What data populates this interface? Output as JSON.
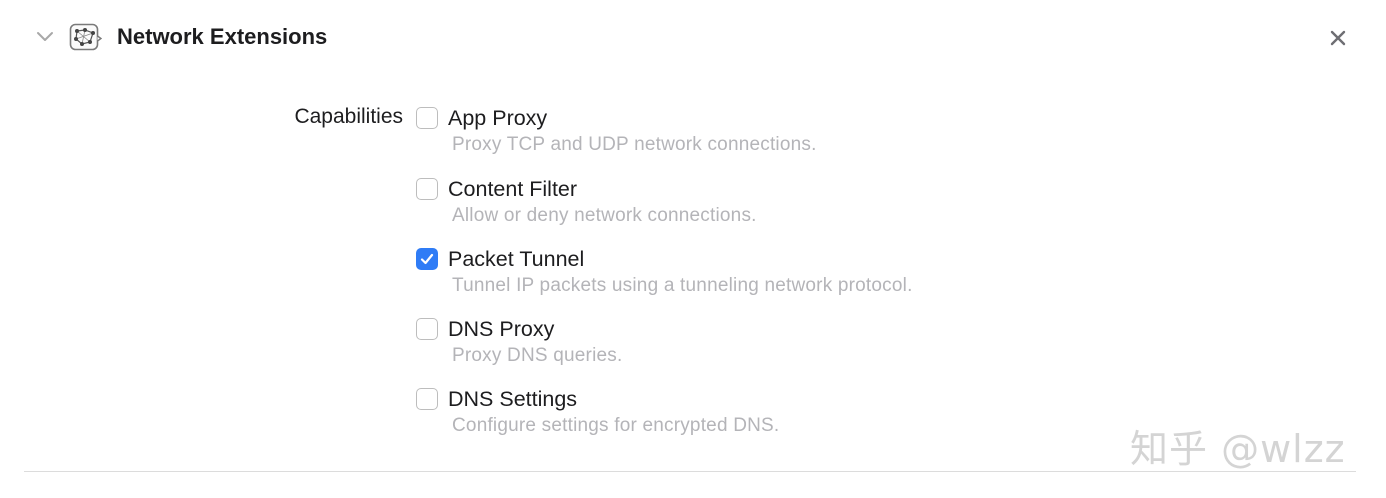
{
  "section": {
    "title": "Network Extensions",
    "icon": "network-extensions-icon"
  },
  "capabilities": {
    "label": "Capabilities",
    "options": [
      {
        "label": "App Proxy",
        "description": "Proxy TCP and UDP network connections.",
        "checked": false
      },
      {
        "label": "Content Filter",
        "description": "Allow or deny network connections.",
        "checked": false
      },
      {
        "label": "Packet Tunnel",
        "description": "Tunnel IP packets using a tunneling network protocol.",
        "checked": true
      },
      {
        "label": "DNS Proxy",
        "description": "Proxy DNS queries.",
        "checked": false
      },
      {
        "label": "DNS Settings",
        "description": "Configure settings for encrypted DNS.",
        "checked": false
      }
    ]
  },
  "watermark": "知乎 @wlzz",
  "colors": {
    "accent": "#2f7cf6",
    "text": "#1d1d1f",
    "secondary_text": "#b4b4b8"
  }
}
